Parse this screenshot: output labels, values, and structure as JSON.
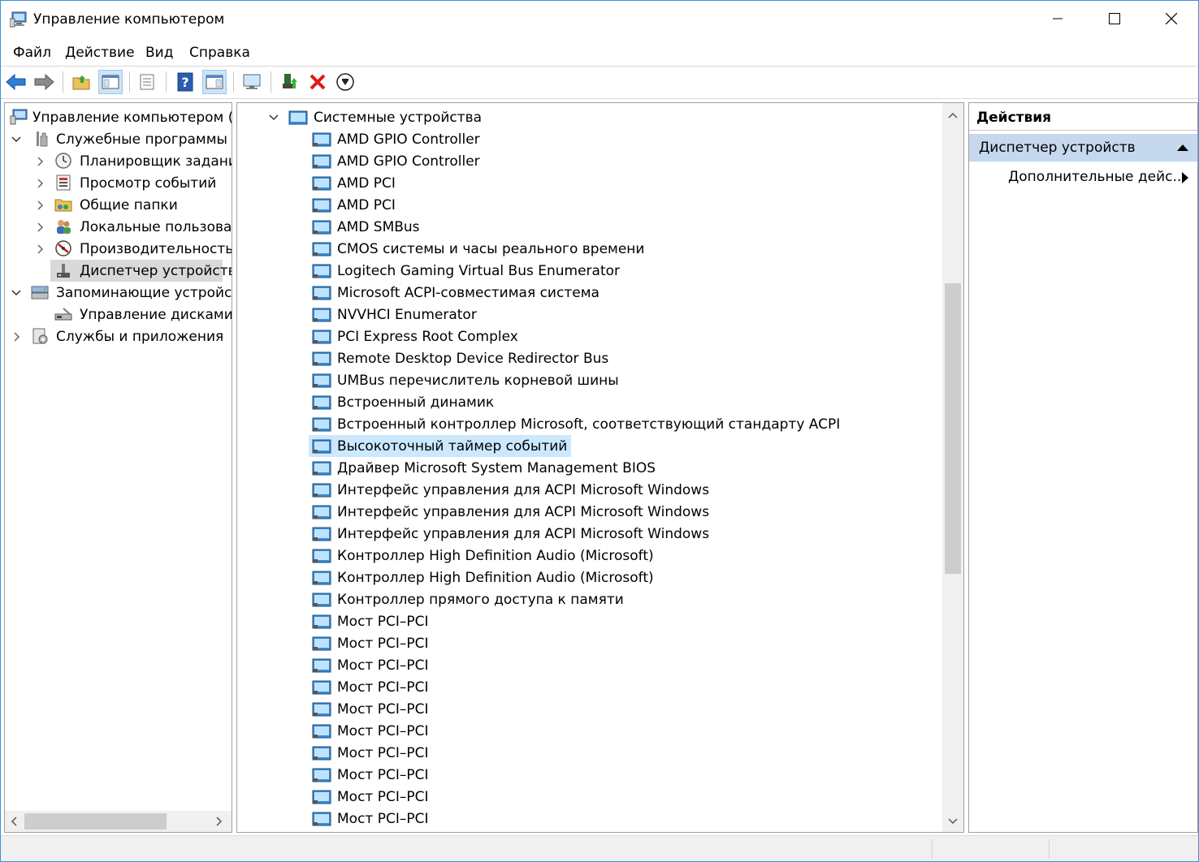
{
  "window": {
    "title": "Управление компьютером"
  },
  "menu": [
    "Файл",
    "Действие",
    "Вид",
    "Справка"
  ],
  "toolbar": {
    "icons": [
      "back-icon",
      "forward-icon",
      "up-folder-icon",
      "show-hide-tree-icon",
      "properties-icon",
      "help-icon",
      "console-view-icon",
      "monitor-icon",
      "update-driver-icon",
      "uninstall-icon",
      "download-icon"
    ]
  },
  "tree": {
    "root": "Управление компьютером (лс",
    "items": [
      {
        "label": "Служебные программы",
        "level": 1,
        "expanded": true
      },
      {
        "label": "Планировщик заданий",
        "level": 2
      },
      {
        "label": "Просмотр событий",
        "level": 2
      },
      {
        "label": "Общие папки",
        "level": 2
      },
      {
        "label": "Локальные пользовате",
        "level": 2
      },
      {
        "label": "Производительность",
        "level": 2
      },
      {
        "label": "Диспетчер устройств",
        "level": 2,
        "selected": true
      },
      {
        "label": "Запоминающие устройств",
        "level": 1,
        "expanded": true
      },
      {
        "label": "Управление дисками",
        "level": 2
      },
      {
        "label": "Службы и приложения",
        "level": 1
      }
    ]
  },
  "devices": {
    "category": "Системные устройства",
    "items": [
      "AMD GPIO Controller",
      "AMD GPIO Controller",
      "AMD PCI",
      "AMD PCI",
      "AMD SMBus",
      "CMOS системы и часы реального времени",
      "Logitech Gaming Virtual Bus Enumerator",
      "Microsoft ACPI-совместимая система",
      "NVVHCI Enumerator",
      "PCI Express Root Complex",
      "Remote Desktop Device Redirector Bus",
      "UMBus перечислитель корневой шины",
      "Встроенный динамик",
      "Встроенный контроллер Microsoft, соответствующий стандарту ACPI",
      "Высокоточный таймер событий",
      "Драйвер Microsoft System Management BIOS",
      "Интерфейс управления для ACPI Microsoft Windows",
      "Интерфейс управления для ACPI Microsoft Windows",
      "Интерфейс управления для ACPI Microsoft Windows",
      "Контроллер High Definition Audio (Microsoft)",
      "Контроллер High Definition Audio (Microsoft)",
      "Контроллер прямого доступа к памяти",
      "Мост PCI–PCI",
      "Мост PCI–PCI",
      "Мост PCI–PCI",
      "Мост PCI–PCI",
      "Мост PCI–PCI",
      "Мост PCI–PCI",
      "Мост PCI–PCI",
      "Мост PCI–PCI",
      "Мост PCI–PCI",
      "Мост PCI–PCI"
    ],
    "selected_index": 14
  },
  "actions": {
    "header": "Действия",
    "section": "Диспетчер устройств",
    "more": "Дополнительные дейс..."
  },
  "colors": {
    "accent_border": "#3c8ed8",
    "selection": "#cce8ff",
    "section_bg": "#c5d8ee"
  }
}
